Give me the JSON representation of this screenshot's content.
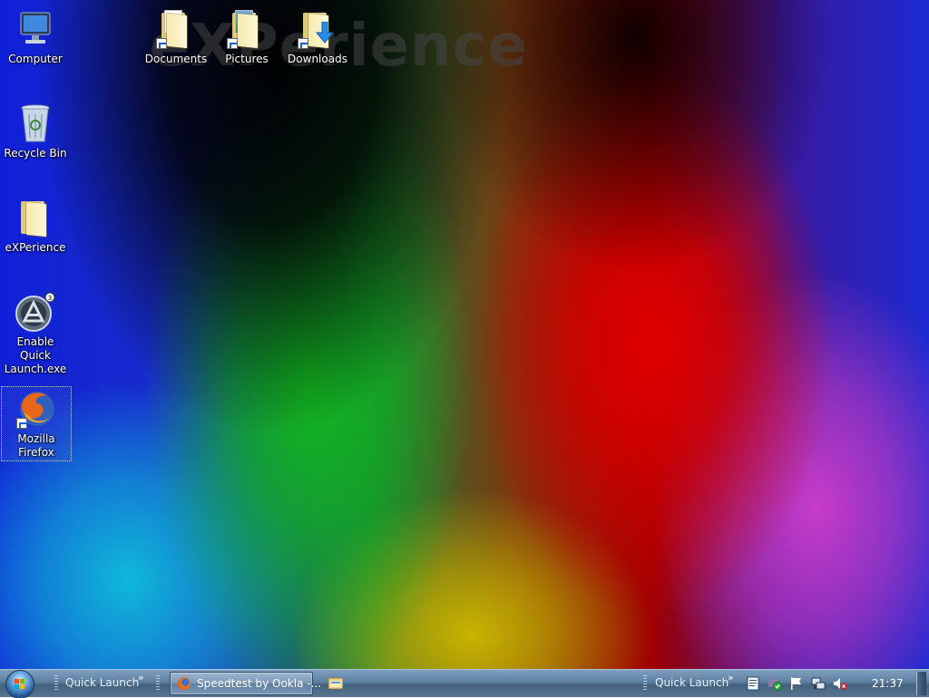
{
  "desktop": {
    "watermark": "eXPerience",
    "icons": [
      {
        "label": "Computer",
        "icon": "computer-icon"
      },
      {
        "label": "Recycle Bin",
        "icon": "recycle-bin-icon"
      },
      {
        "label": "eXPerience",
        "icon": "folder-icon"
      },
      {
        "label": "Enable Quick Launch.exe",
        "icon": "exe-app-icon"
      },
      {
        "label": "Mozilla Firefox",
        "icon": "firefox-icon",
        "selected": true
      },
      {
        "label": "Documents",
        "icon": "documents-folder-icon"
      },
      {
        "label": "Pictures",
        "icon": "pictures-folder-icon"
      },
      {
        "label": "Downloads",
        "icon": "downloads-folder-icon"
      }
    ]
  },
  "taskbar": {
    "start_icon": "windows-start-orb",
    "quick_launch_left": "Quick Launch",
    "chevron": "»",
    "task_button": {
      "label": "Speedtest by Ookla -...",
      "icon": "firefox-icon"
    },
    "explorer_icon": "file-explorer-icon",
    "quick_launch_right": "Quick Launch",
    "tray_icons": [
      "notes-icon",
      "security-shield-icon",
      "action-center-flag-icon",
      "network-icon",
      "volume-muted-icon"
    ],
    "clock": "21:37"
  },
  "colors": {
    "taskbar_top": "#7f9fbf",
    "taskbar_bottom": "#44627f",
    "text_shadow": "#000000"
  }
}
